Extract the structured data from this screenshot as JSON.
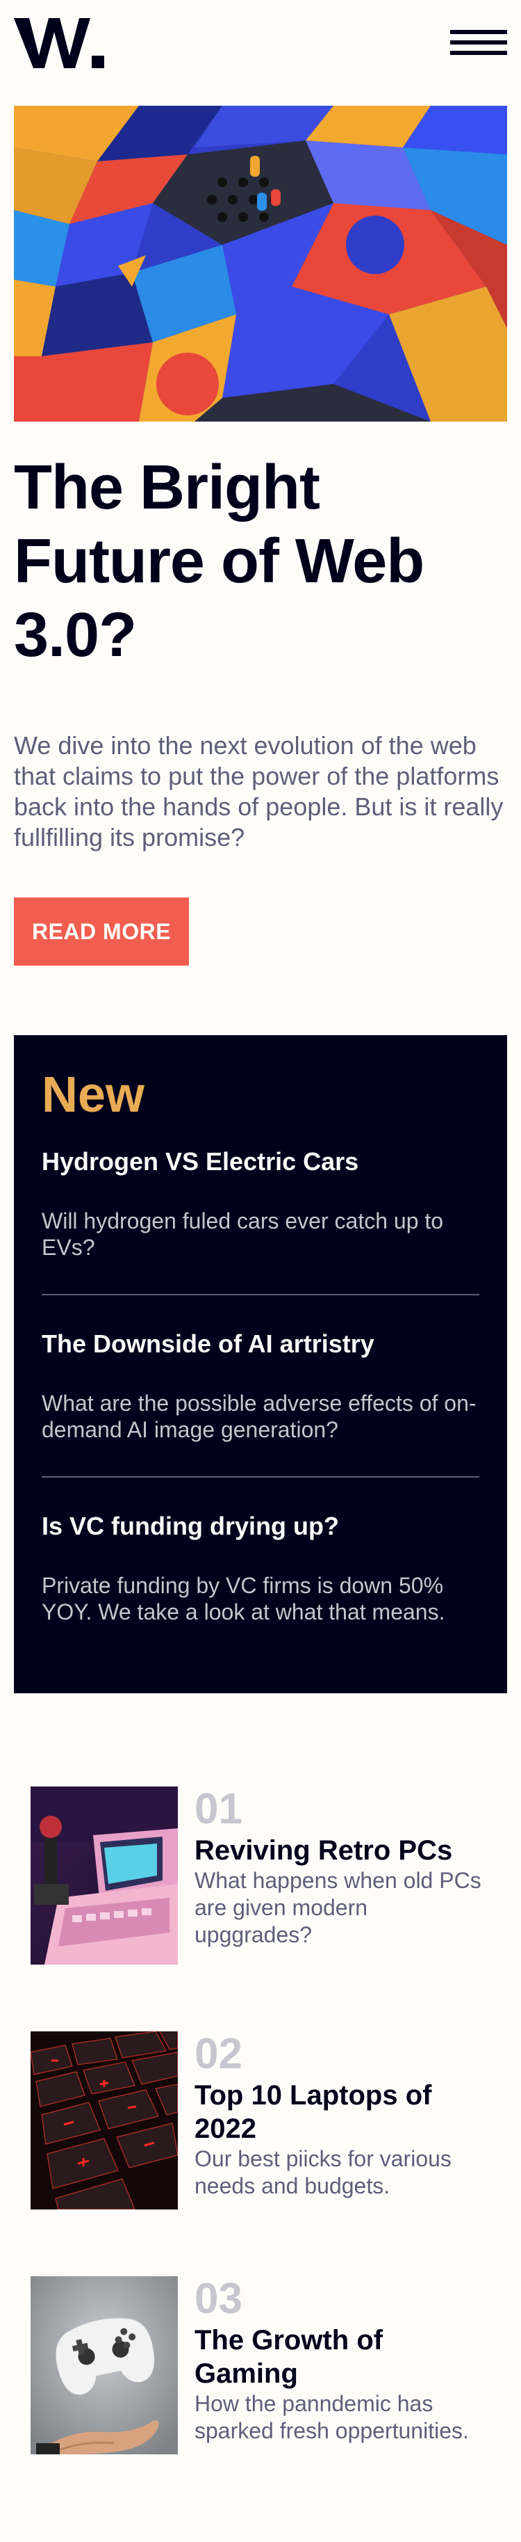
{
  "header": {
    "logo_text": "W.",
    "menu_icon": "hamburger-icon"
  },
  "hero": {
    "image_alt": "Abstract colorful 3D blocks",
    "title": "The Bright Future of Web 3.0?",
    "description": "We dive into the next evolution of the web that claims to put the power of the platforms back into the hands of people. But is it really fullfilling its promise?",
    "cta_label": "READ MORE"
  },
  "new_panel": {
    "heading": "New",
    "items": [
      {
        "title": "Hydrogen VS Electric Cars",
        "description": "Will hydrogen fuled cars ever catch up to EVs?"
      },
      {
        "title": "The Downside of AI artristry",
        "description": "What are the possible adverse effects of on-demand AI image generation?"
      },
      {
        "title": "Is VC funding drying up?",
        "description": "Private funding by VC firms is down 50% YOY. We take a look at what that means."
      }
    ]
  },
  "articles": [
    {
      "number": "01",
      "title": "Reviving Retro PCs",
      "description": "What happens when old PCs are given modern upggrades?",
      "image_alt": "Retro PC with joystick"
    },
    {
      "number": "02",
      "title": "Top 10 Laptops of 2022",
      "description": "Our best piicks for various needs and budgets.",
      "image_alt": "Laptop keyboard with red backlight"
    },
    {
      "number": "03",
      "title": "The Growth of Gaming",
      "description": "How the panndemic has sparked fresh oppertunities.",
      "image_alt": "Game controller floating above hand"
    }
  ],
  "colors": {
    "background": "#fffdfa",
    "dark": "#00001a",
    "accent_red": "#f15e50",
    "accent_gold": "#e9ab53",
    "muted": "#5d5f79",
    "light_gray": "#c5c6ce"
  }
}
